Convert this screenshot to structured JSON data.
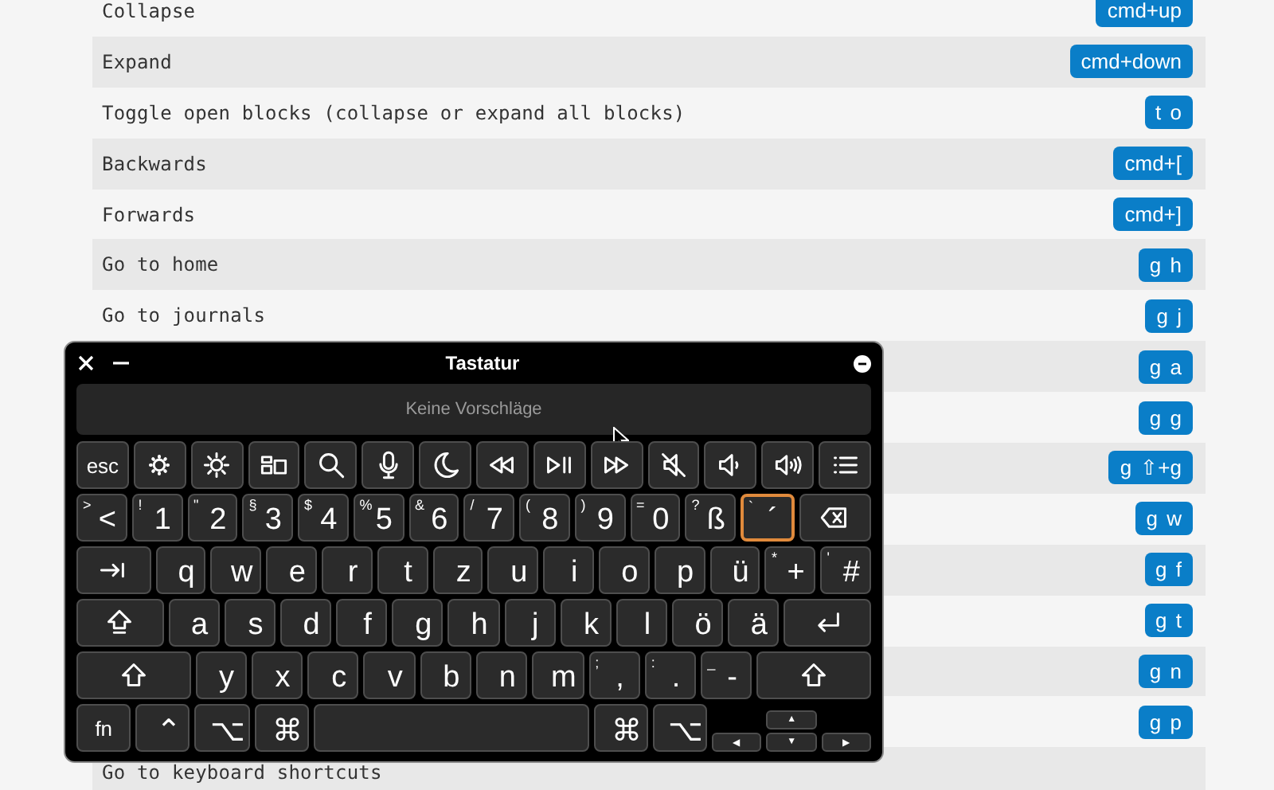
{
  "shortcuts": [
    {
      "label": "Collapse",
      "keys": "cmd+up"
    },
    {
      "label": "Expand",
      "keys": "cmd+down"
    },
    {
      "label": "Toggle open blocks (collapse or expand all blocks)",
      "keys": "t o"
    },
    {
      "label": "Backwards",
      "keys": "cmd+["
    },
    {
      "label": "Forwards",
      "keys": "cmd+]"
    },
    {
      "label": "Go to home",
      "keys": "g h"
    },
    {
      "label": "Go to journals",
      "keys": "g j"
    },
    {
      "keys": "g a"
    },
    {
      "keys": "g g"
    },
    {
      "keys": "g ⇧+g"
    },
    {
      "keys": "g w"
    },
    {
      "keys": "g f"
    },
    {
      "keys": "g t"
    },
    {
      "keys": "g n"
    },
    {
      "keys": "g p"
    },
    {
      "label": "Go to keyboard shortcuts"
    }
  ],
  "keyboard": {
    "title": "Tastatur",
    "suggestions": "Keine Vorschläge",
    "rows": [
      {
        "keys": [
          {
            "kind": "char",
            "main": "esc"
          },
          {
            "kind": "dim"
          },
          {
            "kind": "bright"
          },
          {
            "kind": "windows"
          },
          {
            "kind": "search"
          },
          {
            "kind": "dictation"
          },
          {
            "kind": "focus"
          },
          {
            "kind": "rewind"
          },
          {
            "kind": "playpause"
          },
          {
            "kind": "forward"
          },
          {
            "kind": "mute"
          },
          {
            "kind": "quieter"
          },
          {
            "kind": "louder"
          },
          {
            "kind": "menu"
          }
        ]
      },
      {
        "keys": [
          {
            "kind": "char",
            "shift": ">",
            "main": "<",
            "selected": false
          },
          {
            "kind": "char",
            "shift": "!",
            "main": "1",
            "selected": false
          },
          {
            "kind": "char",
            "shift": "\"",
            "main": "2",
            "selected": false
          },
          {
            "kind": "char",
            "shift": "§",
            "main": "3",
            "selected": false
          },
          {
            "kind": "char",
            "shift": "$",
            "main": "4",
            "selected": false
          },
          {
            "kind": "char",
            "shift": "%",
            "main": "5",
            "selected": false
          },
          {
            "kind": "char",
            "shift": "&",
            "main": "6",
            "selected": false
          },
          {
            "kind": "char",
            "shift": "/",
            "main": "7",
            "selected": false
          },
          {
            "kind": "char",
            "shift": "(",
            "main": "8",
            "selected": false
          },
          {
            "kind": "char",
            "shift": ")",
            "main": "9",
            "selected": false
          },
          {
            "kind": "char",
            "shift": "=",
            "main": "0",
            "selected": false
          },
          {
            "kind": "char",
            "shift": "?",
            "main": "ß",
            "selected": false
          },
          {
            "kind": "char",
            "shift": "`",
            "main": "´",
            "selected": true
          },
          {
            "kind": "backspace"
          }
        ]
      },
      {
        "keys": [
          {
            "kind": "tab"
          },
          {
            "kind": "char",
            "main": "q"
          },
          {
            "kind": "char",
            "main": "w"
          },
          {
            "kind": "char",
            "main": "e"
          },
          {
            "kind": "char",
            "main": "r"
          },
          {
            "kind": "char",
            "main": "t"
          },
          {
            "kind": "char",
            "main": "z"
          },
          {
            "kind": "char",
            "main": "u"
          },
          {
            "kind": "char",
            "main": "i"
          },
          {
            "kind": "char",
            "main": "o"
          },
          {
            "kind": "char",
            "main": "p"
          },
          {
            "kind": "char",
            "main": "ü"
          },
          {
            "kind": "char",
            "shift": "*",
            "main": "+"
          },
          {
            "kind": "char",
            "shift": "'",
            "main": "#"
          }
        ]
      },
      {
        "keys": [
          {
            "kind": "caps"
          },
          {
            "kind": "char",
            "main": "a"
          },
          {
            "kind": "char",
            "main": "s"
          },
          {
            "kind": "char",
            "main": "d"
          },
          {
            "kind": "char",
            "main": "f"
          },
          {
            "kind": "char",
            "main": "g"
          },
          {
            "kind": "char",
            "main": "h"
          },
          {
            "kind": "char",
            "main": "j"
          },
          {
            "kind": "char",
            "main": "k"
          },
          {
            "kind": "char",
            "main": "l"
          },
          {
            "kind": "char",
            "main": "ö"
          },
          {
            "kind": "char",
            "main": "ä"
          },
          {
            "kind": "return"
          }
        ]
      },
      {
        "keys": [
          {
            "kind": "shift"
          },
          {
            "kind": "char",
            "main": "y"
          },
          {
            "kind": "char",
            "main": "x"
          },
          {
            "kind": "char",
            "main": "c"
          },
          {
            "kind": "char",
            "main": "v"
          },
          {
            "kind": "char",
            "main": "b"
          },
          {
            "kind": "char",
            "main": "n"
          },
          {
            "kind": "char",
            "main": "m"
          },
          {
            "kind": "char",
            "shift": ";",
            "main": ","
          },
          {
            "kind": "char",
            "shift": ":",
            "main": "."
          },
          {
            "kind": "char",
            "shift": "_",
            "main": "-"
          },
          {
            "kind": "shift"
          }
        ]
      },
      {
        "keys": [
          {
            "kind": "char",
            "main": "fn"
          },
          {
            "kind": "char",
            "main": "⌃"
          },
          {
            "kind": "char",
            "main": "⌥"
          },
          {
            "kind": "char",
            "main": "⌘"
          },
          {
            "kind": "space"
          },
          {
            "kind": "char",
            "main": "⌘"
          },
          {
            "kind": "char",
            "main": "⌥"
          },
          {
            "kind": "arrows",
            "up": "▲",
            "left": "◀",
            "down": "▼",
            "right": "▶"
          }
        ]
      }
    ]
  }
}
